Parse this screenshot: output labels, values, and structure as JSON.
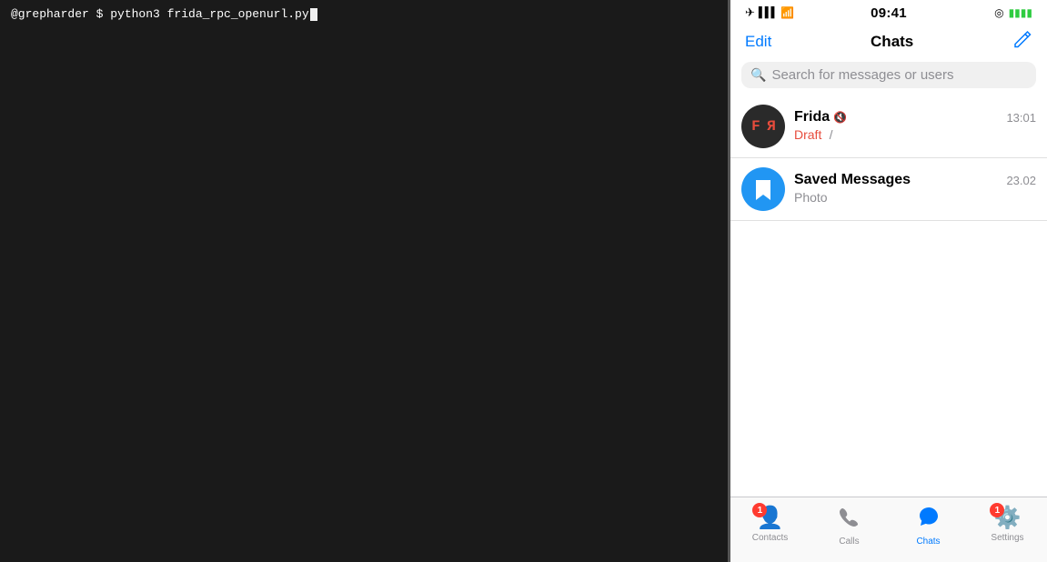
{
  "terminal": {
    "prompt": "@grepharder $ python3 frida_rpc_openurl.py",
    "cursor": true
  },
  "statusBar": {
    "airplane": "✈",
    "signal": "▌▌▌",
    "wifi": "wifi",
    "time": "09:41",
    "location": "◎",
    "battery": "🔋"
  },
  "header": {
    "edit_label": "Edit",
    "title": "Chats",
    "compose_label": "✏"
  },
  "search": {
    "placeholder": "Search for messages or users"
  },
  "chats": [
    {
      "id": "frida",
      "name": "Frida",
      "muted": true,
      "time": "13:01",
      "preview_red": "Draft",
      "preview_suffix": "\n/",
      "avatar_type": "frida"
    },
    {
      "id": "saved",
      "name": "Saved Messages",
      "muted": false,
      "time": "23.02",
      "preview": "Photo",
      "avatar_type": "saved"
    }
  ],
  "tabBar": {
    "tabs": [
      {
        "id": "contacts",
        "label": "Contacts",
        "icon": "👤",
        "badge": "1",
        "active": false
      },
      {
        "id": "calls",
        "label": "Calls",
        "icon": "📞",
        "badge": "",
        "active": false
      },
      {
        "id": "chats",
        "label": "Chats",
        "icon": "💬",
        "badge": "",
        "active": true
      },
      {
        "id": "settings",
        "label": "Settings",
        "icon": "⚙",
        "badge": "1",
        "active": false
      }
    ]
  }
}
